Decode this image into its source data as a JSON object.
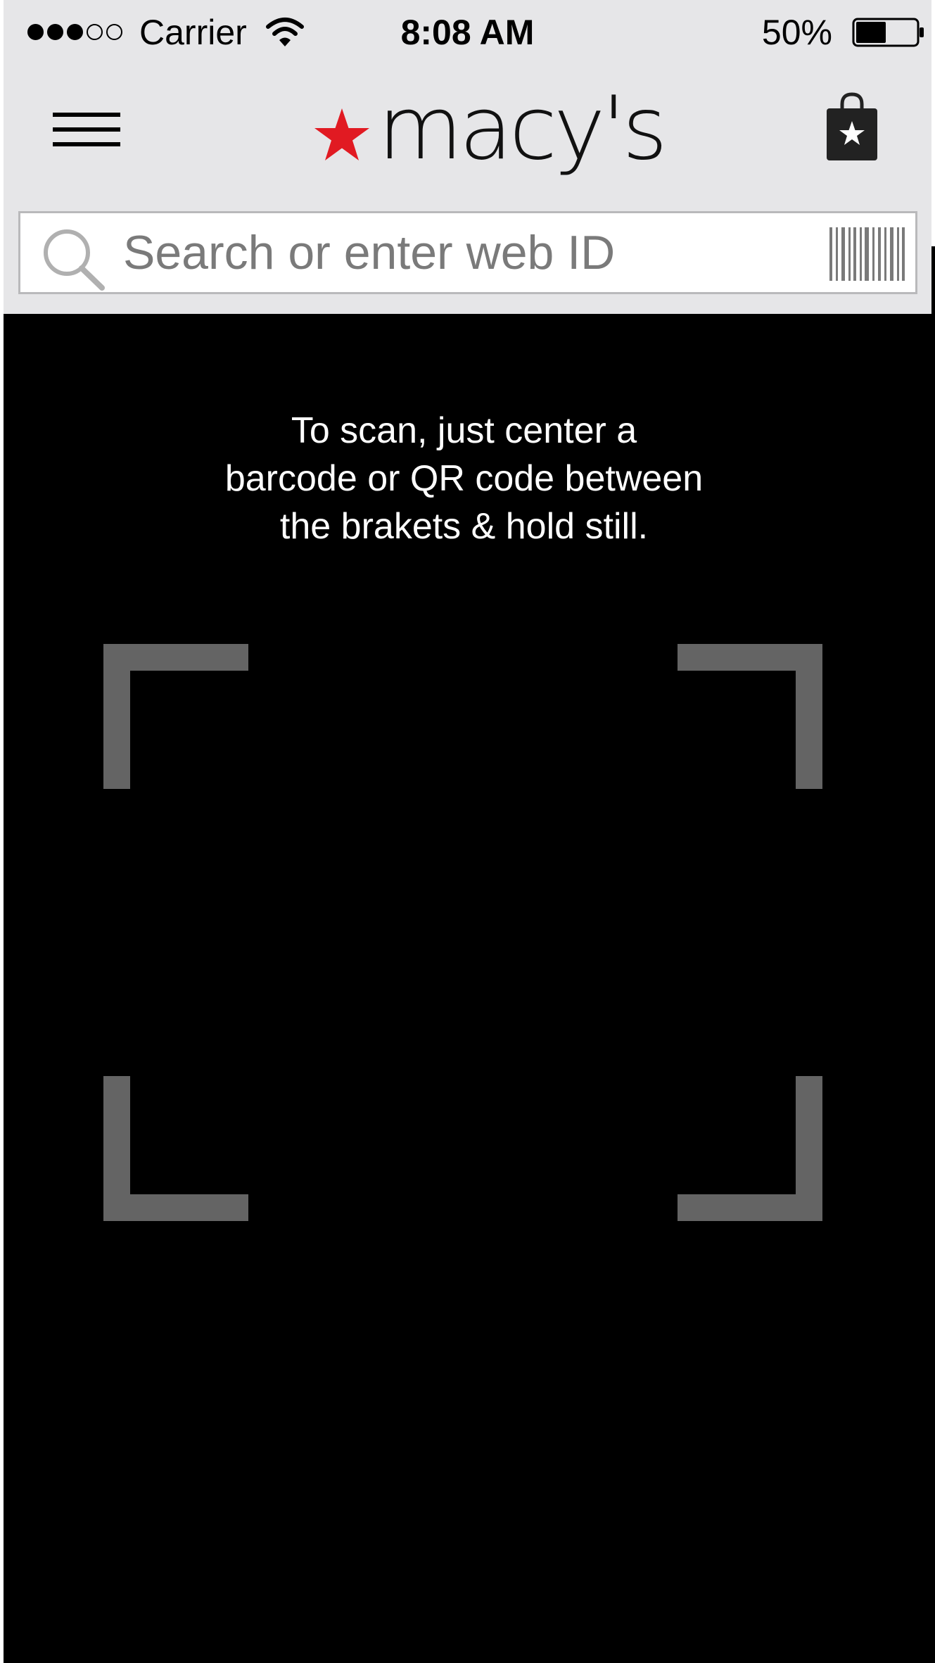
{
  "status_bar": {
    "carrier": "Carrier",
    "time": "8:08 AM",
    "battery": "50%",
    "signal_strength": 3,
    "signal_max": 5,
    "battery_level": 0.5
  },
  "header": {
    "logo_text": "macy's",
    "logo_color": "#e11a22",
    "menu_icon": "hamburger-menu-icon",
    "bag_icon": "shopping-bag-icon"
  },
  "search": {
    "placeholder": "Search or enter web ID",
    "value": "",
    "search_icon": "search-icon",
    "scan_icon": "barcode-icon"
  },
  "scanner": {
    "instructions": [
      "To scan, just center a",
      "barcode or QR code between",
      "the brakets & hold still."
    ],
    "bracket_color": "#646464"
  }
}
